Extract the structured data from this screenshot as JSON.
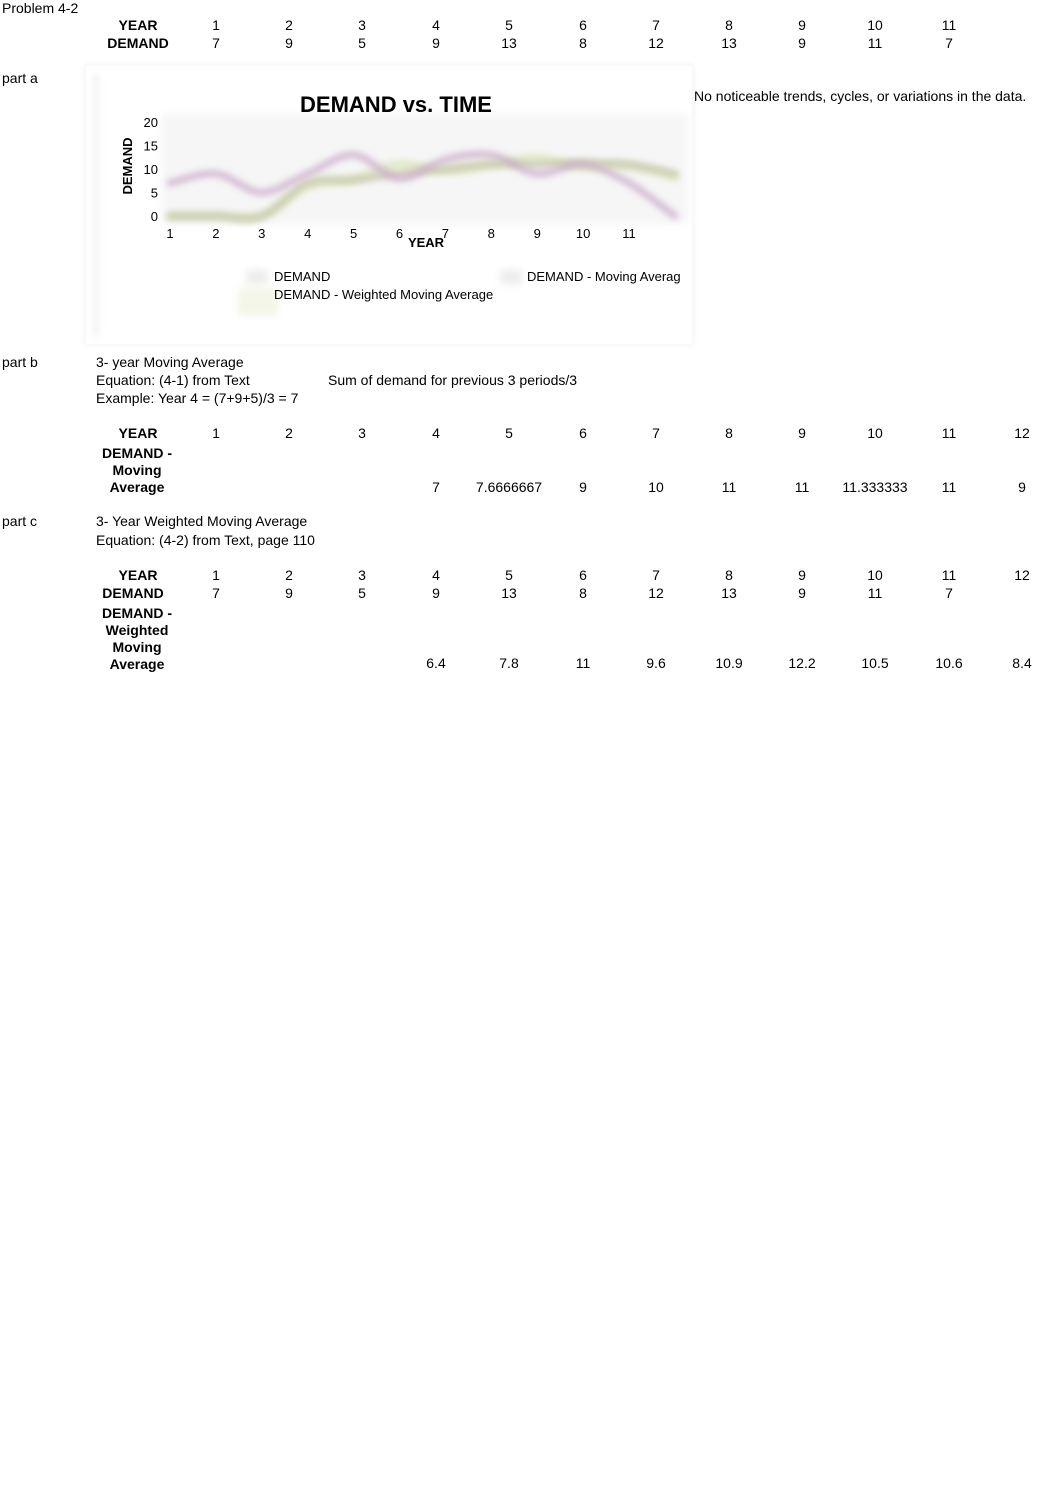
{
  "problem_title": "Problem 4-2",
  "data_table": {
    "year_label": "YEAR",
    "demand_label": "DEMAND",
    "years": [
      "1",
      "2",
      "3",
      "4",
      "5",
      "6",
      "7",
      "8",
      "9",
      "10",
      "11"
    ],
    "demand": [
      "7",
      "9",
      "5",
      "9",
      "13",
      "8",
      "12",
      "13",
      "9",
      "11",
      "7"
    ]
  },
  "part_a": {
    "label": "part a",
    "comment": "No noticeable trends, cycles, or variations in the data."
  },
  "chart_data": {
    "type": "line",
    "title": "DEMAND vs. TIME",
    "xlabel": "YEAR",
    "ylabel": "DEMAND",
    "x_tick_labels": [
      "1",
      "2",
      "3",
      "4",
      "5",
      "6",
      "7",
      "8",
      "9",
      "10",
      "11"
    ],
    "y_tick_labels": [
      "0",
      "5",
      "10",
      "15",
      "20"
    ],
    "ylim": [
      0,
      20
    ],
    "x": [
      1,
      2,
      3,
      4,
      5,
      6,
      7,
      8,
      9,
      10,
      11,
      12
    ],
    "grid": false,
    "legend_position": "bottom",
    "series": [
      {
        "name": "DEMAND",
        "color": "#c9a9c9",
        "values": [
          7,
          9,
          5,
          9,
          13,
          8,
          12,
          13,
          9,
          11,
          7,
          0
        ]
      },
      {
        "name": "DEMAND - Moving Averag",
        "color": "#c8c8b0",
        "values": [
          0,
          0,
          0,
          7,
          7.6666667,
          9,
          10,
          11,
          11,
          11.333333,
          11,
          9
        ]
      },
      {
        "name": "DEMAND - Weighted Moving Average",
        "color": "#dfe8bf",
        "values": [
          0,
          0,
          0,
          6.4,
          7.8,
          11,
          9.6,
          10.9,
          12.2,
          10.5,
          10.6,
          8.4
        ]
      }
    ]
  },
  "part_b": {
    "label": "part b",
    "title": "3- year Moving Average",
    "equation": "Equation:  (4-1) from Text",
    "equation_note": "Sum of demand for previous 3 periods/3",
    "example": "Example:  Year 4 = (7+9+5)/3 = 7",
    "table": {
      "year_label": "YEAR",
      "ma_label": "DEMAND - Moving Average",
      "years": [
        "1",
        "2",
        "3",
        "4",
        "5",
        "6",
        "7",
        "8",
        "9",
        "10",
        "11",
        "12"
      ],
      "ma": [
        "",
        "",
        "",
        "7",
        "7.6666667",
        "9",
        "10",
        "11",
        "11",
        "11.333333",
        "11",
        "9"
      ]
    }
  },
  "part_c": {
    "label": "part c",
    "title": "3- Year Weighted Moving Average",
    "equation": "Equation:  (4-2) from Text, page 110",
    "table": {
      "year_label": "YEAR",
      "demand_label": "DEMAND",
      "wma_label": "DEMAND - Weighted Moving Average",
      "years": [
        "1",
        "2",
        "3",
        "4",
        "5",
        "6",
        "7",
        "8",
        "9",
        "10",
        "11",
        "12"
      ],
      "demand": [
        "7",
        "9",
        "5",
        "9",
        "13",
        "8",
        "12",
        "13",
        "9",
        "11",
        "7",
        ""
      ],
      "wma": [
        "",
        "",
        "",
        "6.4",
        "7.8",
        "11",
        "9.6",
        "10.9",
        "12.2",
        "10.5",
        "10.6",
        "8.4"
      ]
    }
  }
}
